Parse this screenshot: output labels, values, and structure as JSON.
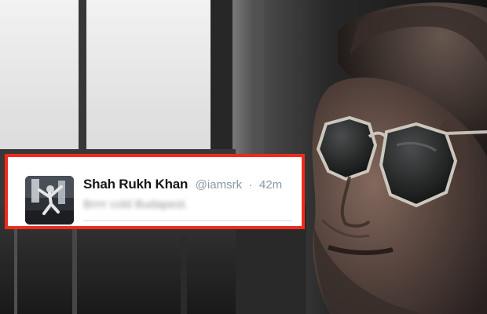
{
  "tweet": {
    "author_name": "Shah Rukh Khan",
    "handle": "@iamsrk",
    "separator": "·",
    "time": "42m",
    "text": "Brrrr cold Budapest."
  },
  "highlight_color": "#ef2a1c",
  "avatar_icon": "profile-photo-icon"
}
